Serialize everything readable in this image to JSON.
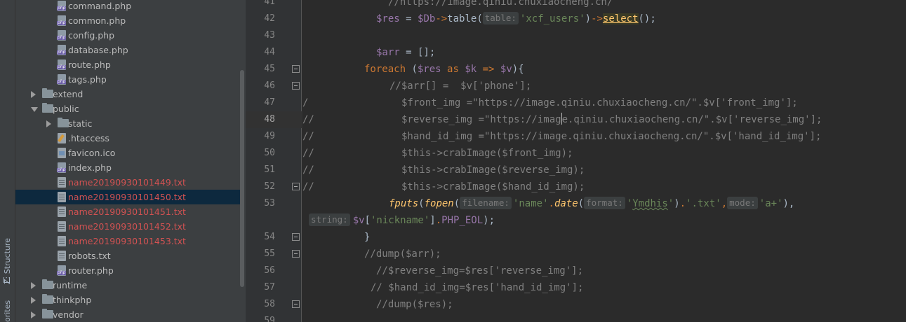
{
  "tool_strip": {
    "structure_label": "Z: Structure",
    "favorites_label": "orites"
  },
  "tree": {
    "rows": [
      {
        "label": "command.php",
        "type": "php"
      },
      {
        "label": "common.php",
        "type": "php"
      },
      {
        "label": "config.php",
        "type": "php"
      },
      {
        "label": "database.php",
        "type": "php"
      },
      {
        "label": "route.php",
        "type": "php"
      },
      {
        "label": "tags.php",
        "type": "php"
      },
      {
        "label": "extend",
        "type": "folder-collapsed"
      },
      {
        "label": "public",
        "type": "folder-expanded"
      },
      {
        "label": "static",
        "type": "folder-collapsed"
      },
      {
        "label": ".htaccess",
        "type": "htaccess"
      },
      {
        "label": "favicon.ico",
        "type": "ico"
      },
      {
        "label": "index.php",
        "type": "php"
      },
      {
        "label": "name20190930101449.txt",
        "type": "txt-red"
      },
      {
        "label": "name20190930101450.txt",
        "type": "txt-red",
        "selected": true
      },
      {
        "label": "name20190930101451.txt",
        "type": "txt-red"
      },
      {
        "label": "name20190930101452.txt",
        "type": "txt-red"
      },
      {
        "label": "name20190930101453.txt",
        "type": "txt-red"
      },
      {
        "label": "robots.txt",
        "type": "txt"
      },
      {
        "label": "router.php",
        "type": "php"
      },
      {
        "label": "runtime",
        "type": "folder-collapsed"
      },
      {
        "label": "thinkphp",
        "type": "folder-collapsed"
      },
      {
        "label": "vendor",
        "type": "folder-collapsed"
      }
    ]
  },
  "editor": {
    "line_numbers": [
      "41",
      "42",
      "43",
      "44",
      "45",
      "46",
      "47",
      "48",
      "49",
      "50",
      "51",
      "52",
      "53",
      "",
      "54",
      "55",
      "56",
      "57",
      "58",
      "59"
    ],
    "active_line": "48",
    "code": {
      "l41": "//https://image.qiniu.chuxiaocheng.cn/",
      "l42_var": "$res",
      "l42_eq": " = ",
      "l42_db": "$Db",
      "l42_arrow": "->",
      "l42_table": "table(",
      "l42_hint": "table:",
      "l42_str": "'xcf_users'",
      "l42_close": ")",
      "l42_arrow2": "->",
      "l42_select": "select",
      "l42_end": "();",
      "l44_var": "$arr",
      "l44_rest": " = [];",
      "l45_kw": "foreach",
      "l45_open": " (",
      "l45_res": "$res",
      "l45_as": " as ",
      "l45_k": "$k",
      "l45_arrow": " => ",
      "l45_v": "$v",
      "l45_close": "){",
      "l46": "//$arr[] =  $v['phone'];",
      "l47_pre": "/",
      "l47": "$front_img =\"https://image.qiniu.chuxiaocheng.cn/\".$v['front_img'];",
      "l48_pre": "//",
      "l48_a": "$reverse_img =\"https://imag",
      "l48_b": "e.qiniu.chuxiaocheng.cn/\".$v['reverse_img'];",
      "l49_pre": "//",
      "l49": "$hand_id_img =\"https://image.qiniu.chuxiaocheng.cn/\".$v['hand_id_img'];",
      "l50_pre": "//",
      "l50": "$this->crabImage($front_img);",
      "l51_pre": "//",
      "l51": "$this->crabImage($reverse_img);",
      "l52_pre": "//",
      "l52": "$this->crabImage($hand_id_img);",
      "l53_fputs": "fputs",
      "l53_p1": "(",
      "l53_fopen": "fopen",
      "l53_p2": "(",
      "l53_hint1": "filename:",
      "l53_name": "'name'",
      "l53_dot1": ".",
      "l53_date": "date",
      "l53_p3": "(",
      "l53_hint2": "format:",
      "l53_fmt_q1": "'",
      "l53_fmt": "Ymdhis",
      "l53_fmt_q2": "'",
      "l53_p4": ")",
      "l53_dot2": ".",
      "l53_txt": "'.txt'",
      "l53_comma": ",",
      "l53_hint3": "mode:",
      "l53_mode": "'a+'",
      "l53_p5": "),",
      "l53b_hint": "string:",
      "l53b_v": "$v",
      "l53b_b1": "[",
      "l53b_key": "'nickname'",
      "l53b_b2": "]",
      "l53b_dot": ".",
      "l53b_eol": "PHP_EOL",
      "l53b_end": ");",
      "l54": "}",
      "l55": "//dump($arr);",
      "l56": "//$reverse_img=$res['reverse_img'];",
      "l57": "// $hand_id_img=$res['hand_id_img'];",
      "l58": "//dump($res);"
    }
  }
}
